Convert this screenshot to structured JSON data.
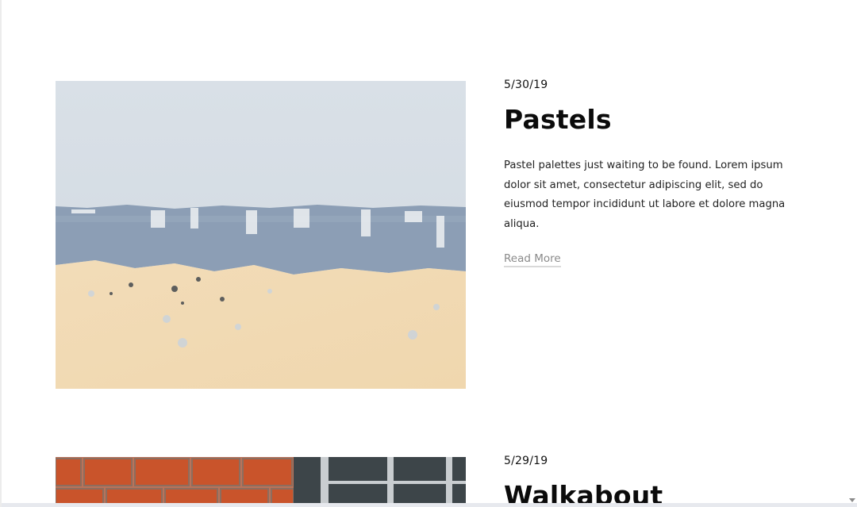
{
  "posts": [
    {
      "date": "5/30/19",
      "title": "Pastels",
      "excerpt": "Pastel palettes just waiting to be found. Lorem ipsum dolor sit amet, consectetur adipiscing elit, sed do eiusmod tempor incididunt ut labore et dolore magna aliqua.",
      "read_more": "Read More",
      "image": "pastel-wall-photo"
    },
    {
      "date": "5/29/19",
      "title": "Walkabout",
      "image": "brick-wall-window-photo"
    }
  ],
  "colors": {
    "pastel_sky": "#d6dde4",
    "pastel_blue": "#8b9db4",
    "pastel_cream": "#f3dcb8",
    "brick": "#c8522a",
    "read_more": "#8a8a8a"
  }
}
